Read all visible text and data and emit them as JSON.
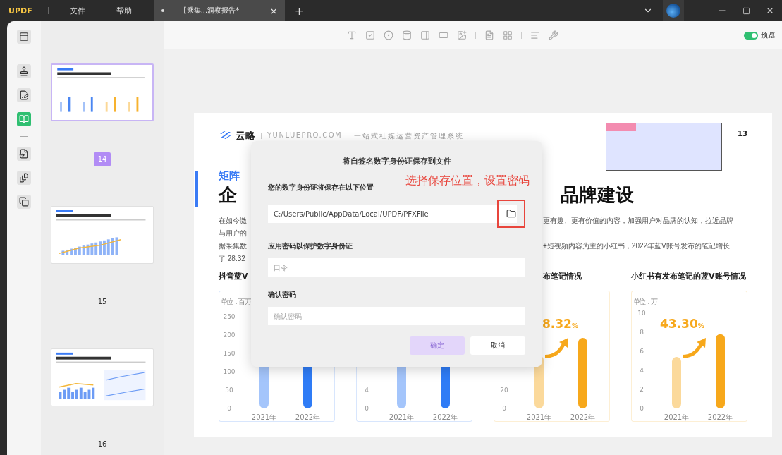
{
  "titlebar": {
    "logo": "UPDF",
    "menu": [
      "文件",
      "帮助"
    ],
    "tab": {
      "title": "【乘集...洞察报告*",
      "close": "×"
    },
    "add_tab": "+"
  },
  "rail_groups": [
    {
      "items": [
        {
          "selected": false
        }
      ]
    },
    {
      "items": [
        {
          "selected": false
        },
        {
          "selected": false
        },
        {
          "selected": true
        }
      ]
    },
    {
      "items": [
        {
          "selected": false
        },
        {
          "selected": false
        },
        {
          "selected": false
        }
      ]
    }
  ],
  "thumbnails": [
    {
      "kind": "four-bars",
      "label": "14",
      "selected": true
    },
    {
      "kind": "combo",
      "label": "15",
      "selected": false
    },
    {
      "kind": "split",
      "label": "16",
      "selected": false
    }
  ],
  "toolbar": {
    "preview": {
      "label": "预览",
      "on": true
    }
  },
  "document": {
    "brand": "云略",
    "site": "YUNLUEPRO.COM",
    "slogan": "一站式社媒运营资产管理系统",
    "page_number": "13",
    "subtitle_left": "矩阵",
    "headline_left": "企",
    "headline_right": "品牌建设",
    "paragraph_left": [
      "在如今激",
      "与用户的",
      "据果集数",
      "了 28.32"
    ],
    "paragraph_right": [
      "更有趣、更有价值的内容，加强用户对品牌的认知，拉近品牌",
      "+短视频内容为主的小红书，2022年蓝V账号发布的笔记增长"
    ],
    "charts": [
      {
        "kind": "drawing",
        "title": "抖音蓝V",
        "unit": "单位：百万",
        "axis_labels": [
          "250",
          "200",
          "150",
          "100",
          "50",
          "0"
        ],
        "categories": [
          "2021年",
          "2022年"
        ],
        "color": "#2f7cf6"
      },
      {
        "kind": "drawing",
        "axis_labels": [
          "4",
          "0"
        ],
        "categories": [
          "2021年",
          "2022年"
        ],
        "color": "#2f7cf6"
      },
      {
        "kind": "drawing",
        "title": "布笔记情况",
        "axis_labels": [
          "20",
          "0"
        ],
        "categories": [
          "2021年",
          "2022年"
        ],
        "color": "#f7a81b",
        "percent": "8.32",
        "percent_unit": "%"
      },
      {
        "kind": "chart",
        "chart_data": {
          "type": "bar",
          "title": "小红书有发布笔记的蓝V账号情况",
          "ylabel": "单位：万",
          "categories": [
            "2021年",
            "2022年"
          ],
          "values": [
            5.4,
            7.8
          ],
          "ylim": [
            0,
            10
          ],
          "yticks": [
            0,
            2,
            4,
            6,
            8,
            10
          ]
        },
        "color": "#f7a81b",
        "percent": "43.30",
        "percent_unit": "%"
      }
    ]
  },
  "dialog": {
    "title": "将自签名数字身份证保存到文件",
    "annotation": "选择保存位置，设置密码",
    "path_label": "您的数字身份证将保存在以下位置",
    "path_value": "C:/Users/Public/AppData/Local/UPDF/PFXFile",
    "password_label": "应用密码以保护数字身份证",
    "password_placeholder": "口令",
    "confirm_label": "确认密码",
    "confirm_placeholder": "确认密码",
    "ok": {
      "label": "确定",
      "disabled": true
    },
    "cancel": "取消"
  }
}
